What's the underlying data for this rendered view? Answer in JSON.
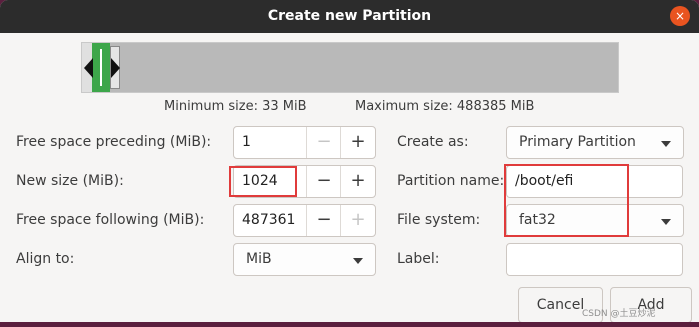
{
  "window": {
    "title": "Create new Partition",
    "close_glyph": "×"
  },
  "size_info": {
    "minimum": "Minimum size: 33 MiB",
    "maximum": "Maximum size: 488385 MiB"
  },
  "left_form": {
    "free_preceding": {
      "label": "Free space preceding (MiB):",
      "value": "1",
      "minus": "−",
      "plus": "+"
    },
    "new_size": {
      "label": "New size (MiB):",
      "value": "1024",
      "minus": "−",
      "plus": "+"
    },
    "free_following": {
      "label": "Free space following (MiB):",
      "value": "487361",
      "minus": "−",
      "plus": "+"
    },
    "align_to": {
      "label": "Align to:",
      "value": "MiB"
    }
  },
  "right_form": {
    "create_as": {
      "label": "Create as:",
      "value": "Primary Partition"
    },
    "partition_name": {
      "label": "Partition name:",
      "value": "/boot/efi"
    },
    "file_system": {
      "label": "File system:",
      "value": "fat32"
    },
    "label": {
      "label": "Label:",
      "value": ""
    }
  },
  "buttons": {
    "cancel": "Cancel",
    "add": "Add"
  },
  "watermark": "CSDN @土豆炒泥",
  "colors": {
    "partition_green": "#3da64a",
    "highlight_red": "#e03b3b",
    "close_orange": "#e95420",
    "titlebar": "#2c2c2c"
  }
}
